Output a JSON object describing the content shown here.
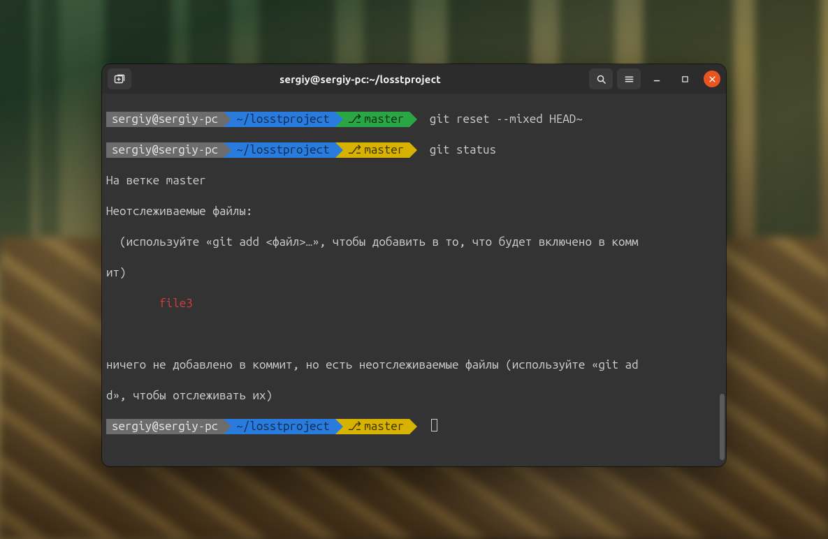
{
  "window": {
    "title": "sergiy@sergiy-pc:~/losstproject"
  },
  "prompt": {
    "user_host": "sergiy@sergiy-pc",
    "path": "~/losstproject",
    "branch": "master",
    "branch_glyph": "⎇"
  },
  "lines": {
    "cmd1": "git reset --mixed HEAD~",
    "cmd2": "git status",
    "out_branch": "На ветке master",
    "out_untracked_hdr": "Неотслеживаемые файлы:",
    "out_untracked_hint1": "  (используйте «git add <файл>…», чтобы добавить в то, что будет включено в комм",
    "out_untracked_hint2": "ит)",
    "out_file": "        file3",
    "out_nothing1": "ничего не добавлено в коммит, но есть неотслеживаемые файлы (используйте «git ad",
    "out_nothing2": "d», чтобы отслеживать их)"
  }
}
